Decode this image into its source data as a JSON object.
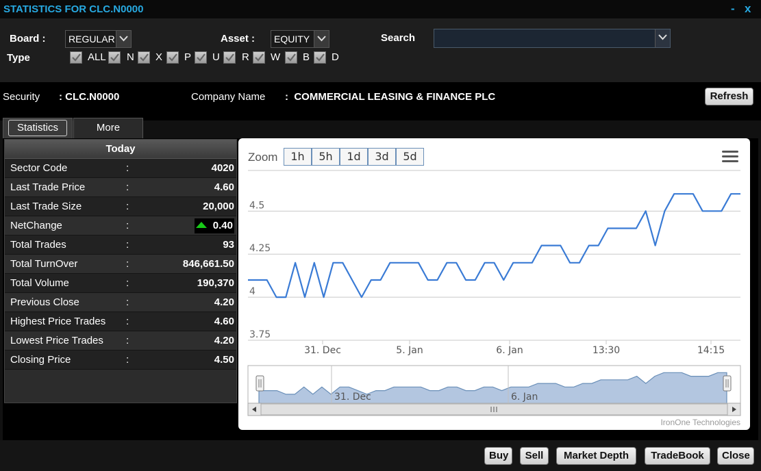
{
  "window": {
    "title": "STATISTICS FOR CLC.N0000",
    "minimize_glyph": "-",
    "close_glyph": "x"
  },
  "filters": {
    "board_label": "Board :",
    "board_value": "REGULAR",
    "asset_label": "Asset :",
    "asset_value": "EQUITY",
    "search_label": "Search",
    "search_value": "",
    "type_label": "Type",
    "types": [
      "ALL",
      "N",
      "X",
      "P",
      "U",
      "R",
      "W",
      "B",
      "D"
    ]
  },
  "security": {
    "security_label": "Security",
    "security_value": ": CLC.N0000",
    "company_label": "Company Name",
    "company_value": ":  COMMERCIAL LEASING & FINANCE PLC",
    "refresh_label": "Refresh"
  },
  "tabs": {
    "statistics": "Statistics",
    "more": "More"
  },
  "stats": {
    "header": "Today",
    "rows": [
      {
        "label": "Sector Code",
        "sep": ":",
        "value": "4020"
      },
      {
        "label": "Last Trade Price",
        "sep": ":",
        "value": "4.60"
      },
      {
        "label": "Last Trade Size",
        "sep": ":",
        "value": "20,000"
      },
      {
        "label": "NetChange",
        "sep": ":",
        "value": "0.40"
      },
      {
        "label": "Total Trades",
        "sep": ":",
        "value": "93"
      },
      {
        "label": "Total TurnOver",
        "sep": ":",
        "value": "846,661.50"
      },
      {
        "label": "Total Volume",
        "sep": ":",
        "value": "190,370"
      },
      {
        "label": "Previous Close",
        "sep": ":",
        "value": "4.20"
      },
      {
        "label": "Highest Price Trades",
        "sep": ":",
        "value": "4.60"
      },
      {
        "label": "Lowest Price Trades",
        "sep": ":",
        "value": "4.20"
      },
      {
        "label": "Closing Price",
        "sep": ":",
        "value": "4.50"
      }
    ],
    "netchange_direction": "up",
    "up_color": "#18c918"
  },
  "chart": {
    "zoom_label": "Zoom",
    "zoom_buttons": [
      "1h",
      "5h",
      "1d",
      "3d",
      "5d"
    ],
    "credits": "IronOne Technologies",
    "navigator_labels": [
      "31. Dec",
      "6. Jan"
    ],
    "line_color": "#3a7bd5",
    "menu_icon": "hamburger-menu-icon"
  },
  "chart_data": {
    "type": "line",
    "title": "",
    "xlabel": "",
    "ylabel": "",
    "x_ticks": [
      "31. Dec",
      "5. Jan",
      "6. Jan",
      "13:30",
      "14:15"
    ],
    "y_ticks": [
      3.75,
      4,
      4.25,
      4.5
    ],
    "ylim": [
      3.75,
      4.72
    ],
    "grid": true,
    "series": [
      {
        "values": [
          4.1,
          4.1,
          4.1,
          4.0,
          4.0,
          4.2,
          4.0,
          4.2,
          4.0,
          4.2,
          4.2,
          4.1,
          4.0,
          4.1,
          4.1,
          4.2,
          4.2,
          4.2,
          4.2,
          4.1,
          4.1,
          4.2,
          4.2,
          4.1,
          4.1,
          4.2,
          4.2,
          4.1,
          4.2,
          4.2,
          4.2,
          4.3,
          4.3,
          4.3,
          4.2,
          4.2,
          4.3,
          4.3,
          4.4,
          4.4,
          4.4,
          4.4,
          4.5,
          4.3,
          4.5,
          4.6,
          4.6,
          4.6,
          4.5,
          4.5,
          4.5,
          4.6,
          4.6
        ]
      }
    ]
  },
  "bottom_buttons": [
    "Buy",
    "Sell",
    "Market Depth",
    "TradeBook",
    "Close"
  ]
}
